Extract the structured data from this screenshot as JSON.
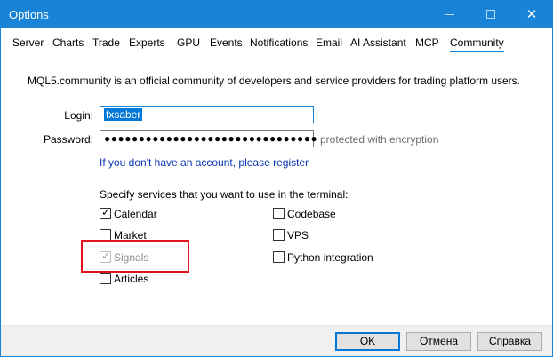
{
  "window": {
    "title": "Options"
  },
  "titlebar": {
    "minimize": "—",
    "maximize": "☐",
    "close": "✕"
  },
  "tabs": [
    {
      "label": "Server"
    },
    {
      "label": "Charts"
    },
    {
      "label": "Trade"
    },
    {
      "label": "Experts"
    },
    {
      "label": "GPU"
    },
    {
      "label": "Events"
    },
    {
      "label": "Notifications"
    },
    {
      "label": "Email"
    },
    {
      "label": "AI Assistant"
    },
    {
      "label": "MCP"
    },
    {
      "label": "Community",
      "active": true
    }
  ],
  "community": {
    "intro": "MQL5.community is an official community of developers and service providers for trading platform users.",
    "login_label": "Login:",
    "login_value": "fxsaber",
    "password_label": "Password:",
    "password_value": "●●●●●●●●●●●●●●●●●●●●●●●●●●●●●●●",
    "password_hint": "protected with encryption",
    "register_link": "If you don't have an account, please register",
    "services_label": "Specify services that you want to use in the terminal:",
    "services": [
      {
        "label": "Calendar",
        "checked": true,
        "disabled": false
      },
      {
        "label": "Market",
        "checked": false,
        "disabled": false
      },
      {
        "label": "Signals",
        "checked": true,
        "disabled": true
      },
      {
        "label": "Articles",
        "checked": false,
        "disabled": false
      },
      {
        "label": "Codebase",
        "checked": false,
        "disabled": false
      },
      {
        "label": "VPS",
        "checked": false,
        "disabled": false
      },
      {
        "label": "Python integration",
        "checked": false,
        "disabled": false
      }
    ]
  },
  "buttons": {
    "ok": "OK",
    "cancel": "Отмена",
    "help": "Справка"
  },
  "colors": {
    "accent": "#1883d7",
    "highlight": "#e0151e",
    "link": "#0a37b5"
  }
}
